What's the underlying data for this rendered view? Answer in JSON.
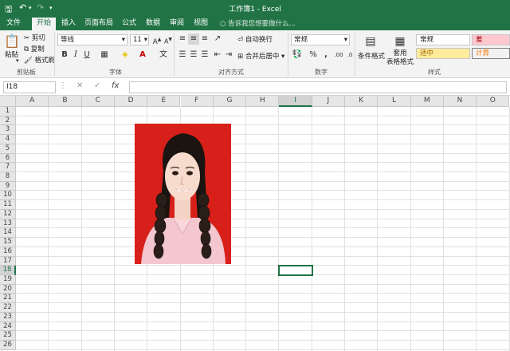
{
  "app": {
    "title": "工作簿1 - Excel"
  },
  "tabs": [
    "文件",
    "开始",
    "插入",
    "页面布局",
    "公式",
    "数据",
    "审阅",
    "视图"
  ],
  "tell_me": "告诉我您想要做什么...",
  "clipboard": {
    "paste": "粘贴",
    "cut": "剪切",
    "copy": "复制",
    "format_painter": "格式刷",
    "group": "剪贴板"
  },
  "font": {
    "name": "等线",
    "size": "11",
    "group": "字体"
  },
  "alignment": {
    "wrap": "自动换行",
    "merge": "合并后居中",
    "group": "对齐方式"
  },
  "number": {
    "format": "常规",
    "group": "数字"
  },
  "styles": {
    "conditional": "条件格式",
    "table": "套用\n表格格式",
    "normal": "常规",
    "bad": "差",
    "neutral": "适中",
    "calc": "计算",
    "group": "样式"
  },
  "namebox": "I18",
  "formula": "",
  "columns": [
    "A",
    "B",
    "C",
    "D",
    "E",
    "F",
    "G",
    "H",
    "I",
    "J",
    "K",
    "L",
    "M",
    "N",
    "O"
  ],
  "rows": [
    "1",
    "2",
    "3",
    "4",
    "5",
    "6",
    "7",
    "8",
    "9",
    "10",
    "11",
    "12",
    "13",
    "14",
    "15",
    "16",
    "17",
    "18",
    "19",
    "20",
    "21",
    "22",
    "23",
    "24",
    "25",
    "26"
  ],
  "selected": {
    "col": "I",
    "row": "18"
  },
  "colors": {
    "accent": "#217346",
    "photo_bg": "#d8201a"
  }
}
